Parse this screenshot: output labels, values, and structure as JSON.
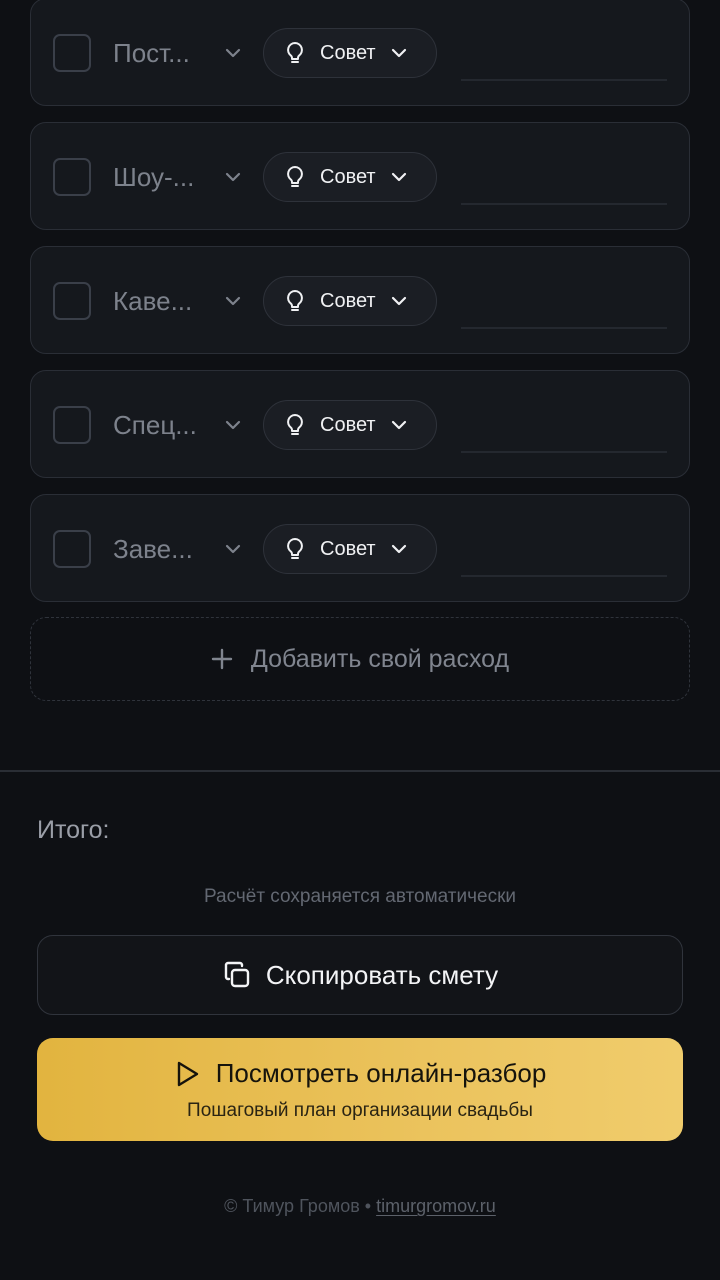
{
  "expenses": [
    {
      "category": "Пост...",
      "tip_label": "Совет"
    },
    {
      "category": "Шоу-...",
      "tip_label": "Совет"
    },
    {
      "category": "Каве...",
      "tip_label": "Совет"
    },
    {
      "category": "Спец...",
      "tip_label": "Совет"
    },
    {
      "category": "Заве...",
      "tip_label": "Совет"
    }
  ],
  "add_expense_label": "Добавить свой расход",
  "summary": {
    "total_label": "Итого:",
    "autosave_note": "Расчёт сохраняется автоматически",
    "copy_button_label": "Скопировать смету"
  },
  "cta": {
    "title": "Посмотреть онлайн-разбор",
    "subtitle": "Пошаговый план организации свадьбы"
  },
  "footer": {
    "author": "© Тимур Громов",
    "separator": "•",
    "link": "timurgromov.ru"
  },
  "colors": {
    "background": "#0e1014",
    "card": "#15181d",
    "accent_gold": "#e8bc4e"
  },
  "icons": [
    "chevron-down-icon",
    "lightbulb-icon",
    "plus-icon",
    "copy-icon",
    "play-icon"
  ]
}
